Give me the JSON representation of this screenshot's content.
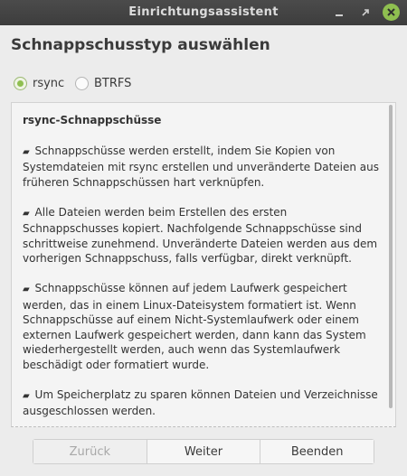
{
  "window": {
    "title": "Einrichtungsassistent",
    "controls": [
      {
        "name": "minimize",
        "icon": "minimize-icon"
      },
      {
        "name": "maximize",
        "icon": "maximize-icon"
      },
      {
        "name": "close",
        "icon": "close-icon"
      }
    ]
  },
  "page": {
    "heading": "Schnappschusstyp auswählen"
  },
  "snapshot_type": {
    "options": [
      {
        "label": "rsync",
        "selected": true
      },
      {
        "label": "BTRFS",
        "selected": false
      }
    ]
  },
  "description": {
    "title": "rsync-Schnappschüsse",
    "bullet_symbol": "▰",
    "paragraphs": [
      "Schnappschüsse werden erstellt, indem Sie Kopien von Systemdateien mit rsync erstellen und unveränderte Dateien aus früheren Schnappschüssen hart verknüpfen.",
      "Alle Dateien werden beim Erstellen des ersten Schnappschusses kopiert. Nachfolgende Schnappschüsse sind schrittweise zunehmend. Unveränderte Dateien werden aus dem vorherigen Schnappschuss, falls verfügbar, direkt verknüpft.",
      "Schnappschüsse können auf jedem Laufwerk gespeichert werden, das in einem Linux-Dateisystem formatiert ist. Wenn Schnappschüsse auf einem Nicht-Systemlaufwerk oder einem externen Laufwerk gespeichert werden, dann kann das System wiederhergestellt werden, auch wenn das Systemlaufwerk beschädigt oder formatiert wurde.",
      "Um Speicherplatz zu sparen können Dateien und Verzeichnisse ausgeschlossen werden."
    ]
  },
  "buttons": {
    "back": "Zurück",
    "next": "Weiter",
    "quit": "Beenden"
  },
  "colors": {
    "accent": "#8fbf50",
    "titlebar": "#404040",
    "background": "#ececec"
  }
}
